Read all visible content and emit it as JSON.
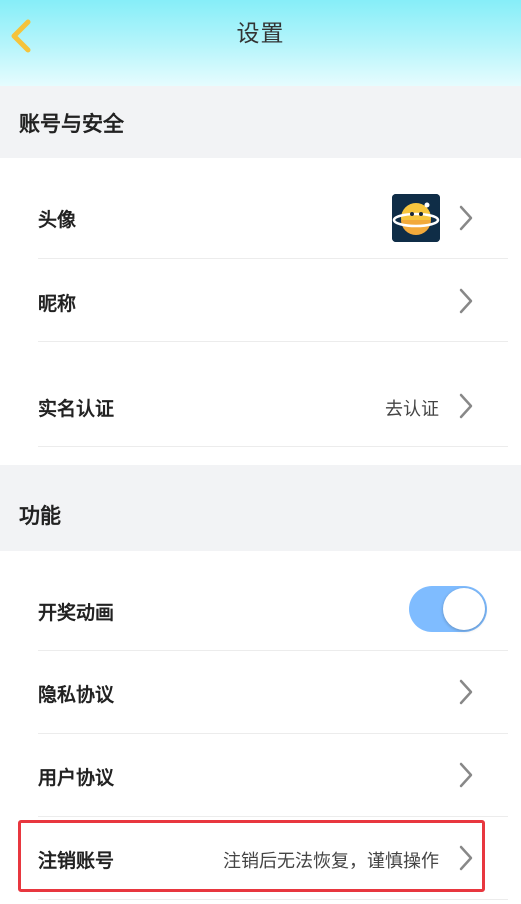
{
  "header": {
    "title": "设置",
    "back_icon": "chevron-left-icon",
    "back_color": "#f5c33b"
  },
  "account_section": {
    "title": "账号与安全",
    "avatar_row": {
      "label": "头像",
      "avatar_icon": "planet-avatar-icon"
    },
    "nickname_row": {
      "label": "昵称"
    },
    "realname_row": {
      "label": "实名认证",
      "value": "去认证"
    }
  },
  "feature_section": {
    "title": "功能",
    "animation_row": {
      "label": "开奖动画",
      "toggle_on": true,
      "toggle_color": "#7fbcff"
    },
    "privacy_row": {
      "label": "隐私协议"
    },
    "user_agreement_row": {
      "label": "用户协议"
    },
    "cancel_row": {
      "label": "注销账号",
      "value": "注销后无法恢复，谨慎操作",
      "highlight_color": "#e8373f"
    }
  },
  "icons": {
    "row_chevron": "chevron-right-icon"
  }
}
